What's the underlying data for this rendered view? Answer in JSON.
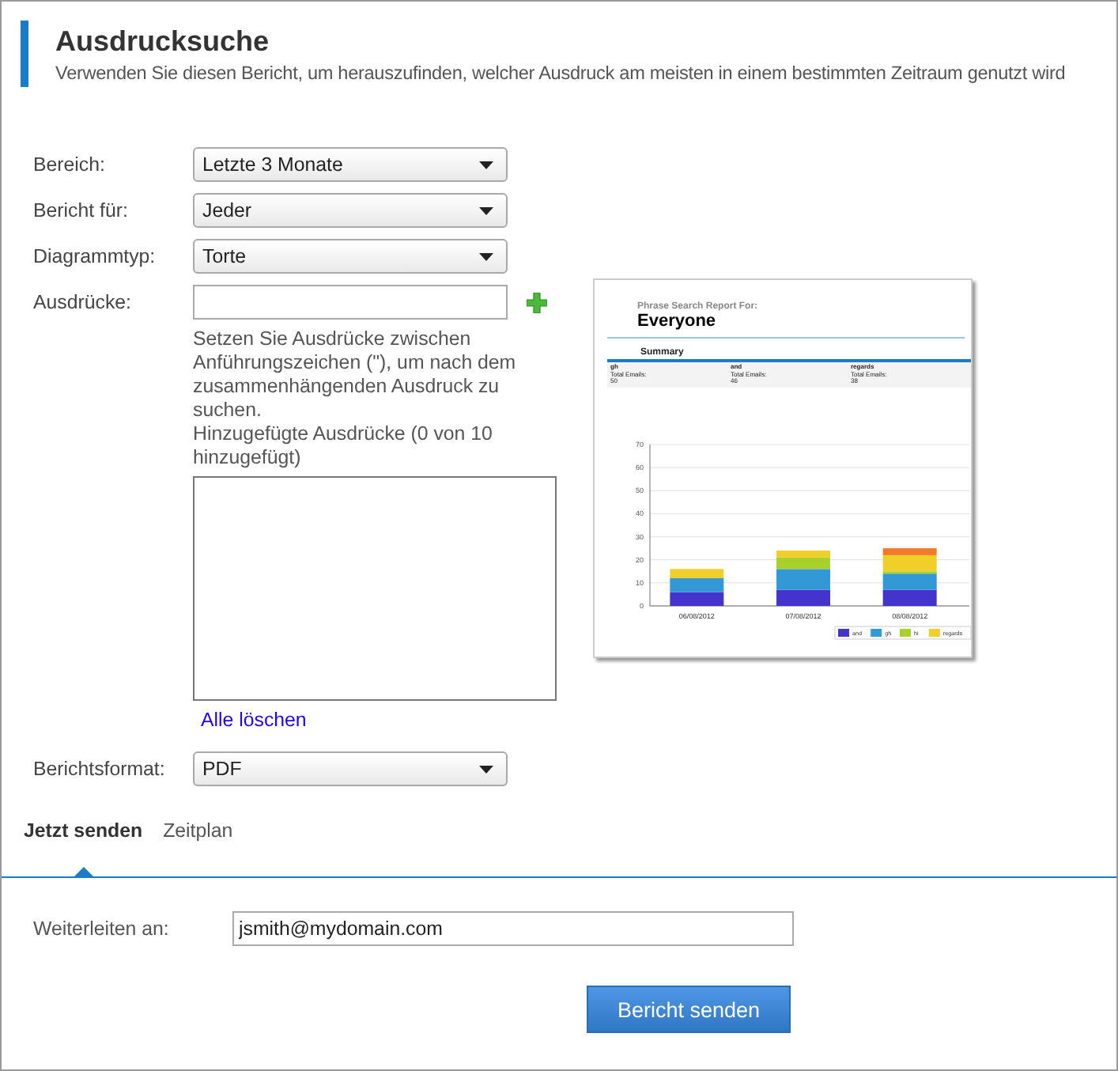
{
  "header": {
    "title": "Ausdrucksuche",
    "subtitle": "Verwenden Sie diesen Bericht, um herauszufinden, welcher Ausdruck am meisten in einem bestimmten Zeitraum genutzt wird"
  },
  "form": {
    "rows": [
      {
        "kind": "select",
        "label": "Bereich:",
        "value": "Letzte 3 Monate"
      },
      {
        "kind": "select",
        "label": "Bericht für:",
        "value": "Jeder"
      },
      {
        "kind": "select",
        "label": "Diagrammtyp:",
        "value": "Torte"
      },
      {
        "kind": "phrases",
        "label": "Ausdrücke:",
        "help": "Setzen Sie Ausdrücke zwischen Anführungszeichen (\"), um nach dem zusammenhängenden Ausdruck zu suchen.",
        "added_note": "Hinzugefügte Ausdrücke (0 von 10 hinzugefügt)",
        "clear_link": "Alle löschen"
      },
      {
        "kind": "select",
        "label": "Berichtsformat:",
        "value": "PDF"
      }
    ]
  },
  "preview": {
    "heading": "Phrase Search Report For:",
    "title": "Everyone",
    "summary_title": "Summary",
    "summary": [
      {
        "phrase": "gh",
        "label": "Total Emails:",
        "count": "50"
      },
      {
        "phrase": "and",
        "label": "Total Emails:",
        "count": "46"
      },
      {
        "phrase": "regards",
        "label": "Total Emails:",
        "count": "38"
      }
    ],
    "chart_data": {
      "type": "bar",
      "stacked": true,
      "grid": true,
      "legend": true,
      "categories": [
        "06/08/2012",
        "07/08/2012",
        "08/08/2012"
      ],
      "ylim": [
        0,
        70
      ],
      "yticks": [
        0,
        10,
        20,
        30,
        40,
        50,
        60,
        70
      ],
      "series": [
        {
          "name": "and",
          "color": "#4433cc",
          "values": [
            6,
            7,
            7
          ]
        },
        {
          "name": "gh",
          "color": "#3399d6",
          "values": [
            6,
            9,
            7
          ]
        },
        {
          "name": "hi",
          "color": "#a8d12c",
          "values": [
            0,
            5,
            1
          ]
        },
        {
          "name": "regards",
          "color": "#f0cf2a",
          "values": [
            4,
            3,
            7
          ]
        },
        {
          "color": "#f07a2a",
          "values": [
            0,
            0,
            3
          ]
        }
      ]
    }
  },
  "tabs": [
    {
      "label": "Jetzt senden",
      "selected": true
    },
    {
      "label": "Zeitplan",
      "selected": false
    }
  ],
  "forward": {
    "label": "Weiterleiten an:",
    "value": "jsmith@mydomain.com"
  },
  "send_button": "Bericht senden"
}
